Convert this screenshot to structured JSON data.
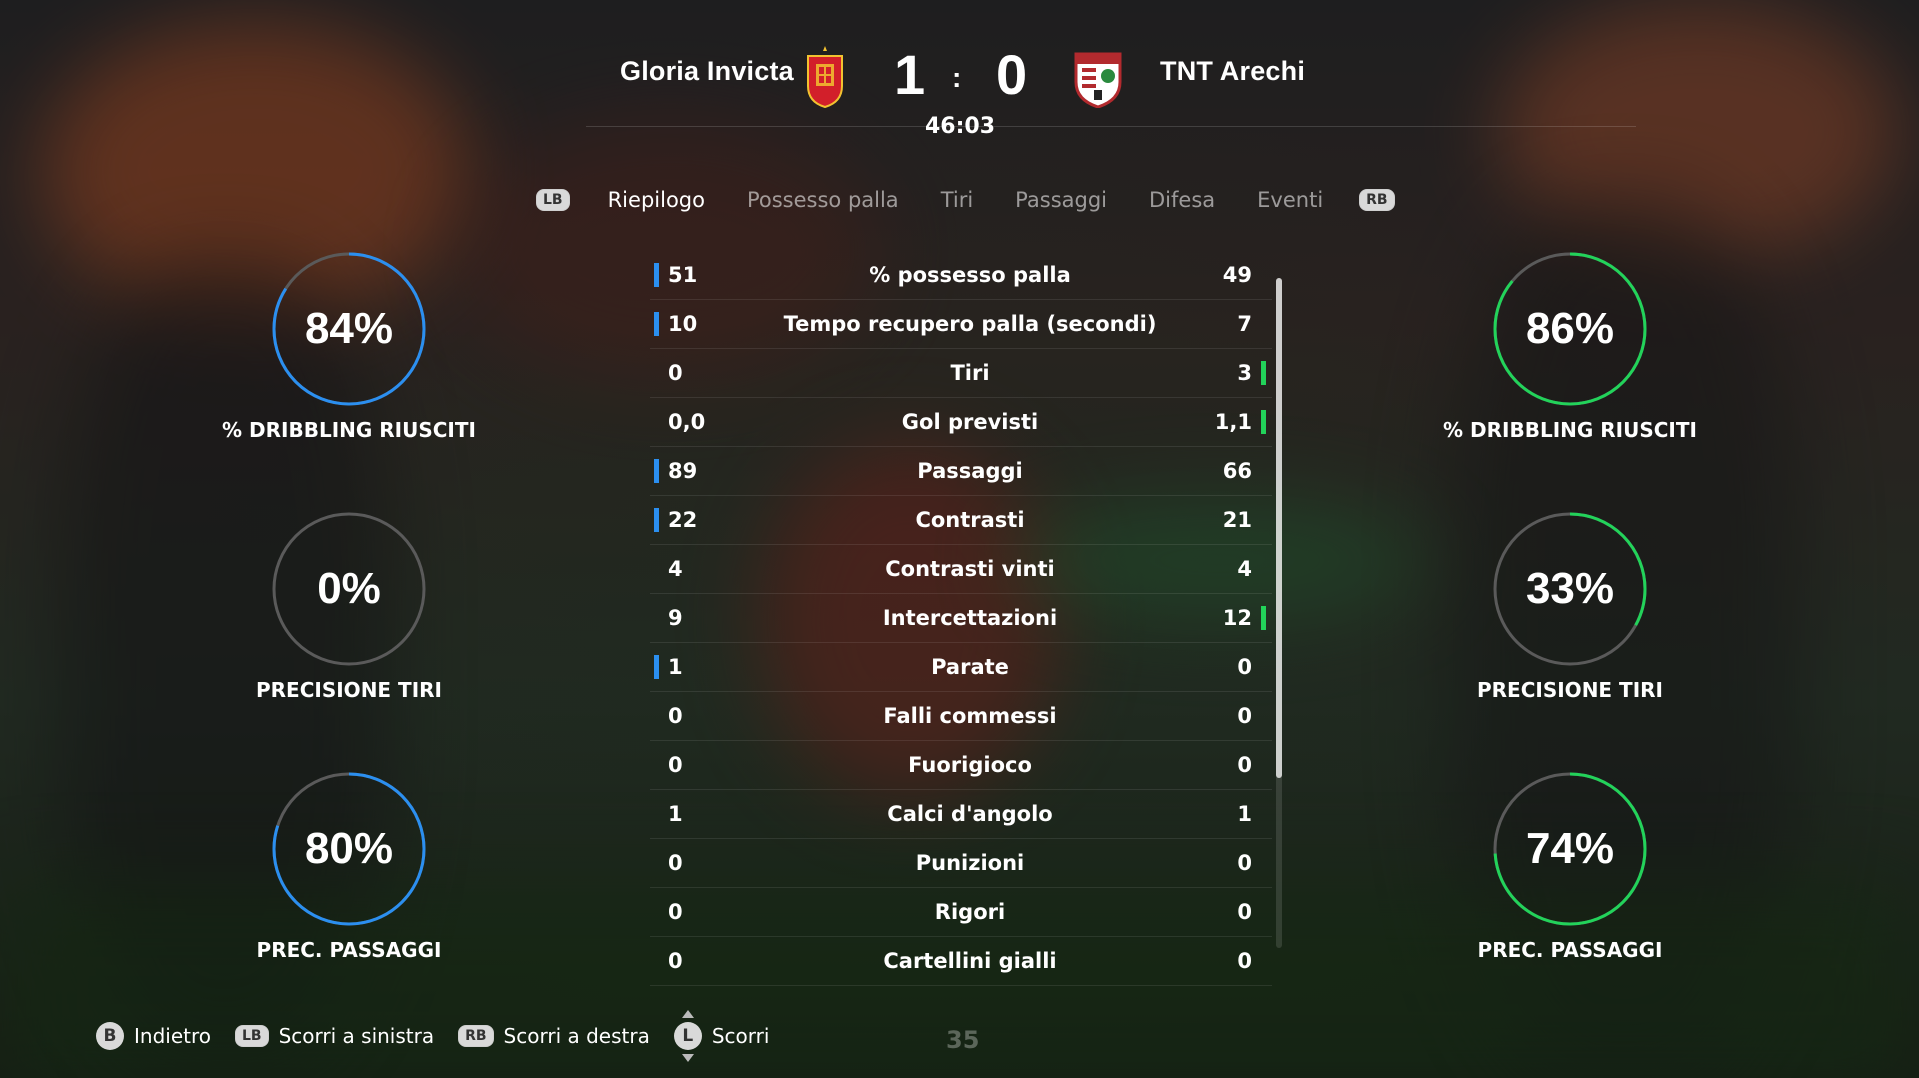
{
  "match": {
    "home_team": "Gloria Invicta",
    "away_team": "TNT Arechi",
    "home_score": "1",
    "away_score": "0",
    "separator": ":",
    "clock": "46:03",
    "home_crest_icon": "spain-crest-icon",
    "away_crest_icon": "club-crest-icon"
  },
  "tabs": {
    "lb": "LB",
    "rb": "RB",
    "items": [
      "Riepilogo",
      "Possesso palla",
      "Tiri",
      "Passaggi",
      "Difesa",
      "Eventi"
    ],
    "active": "Riepilogo"
  },
  "colors": {
    "home": "#2b8ff0",
    "away": "#22d35a",
    "ring_track": "#5a5a5a"
  },
  "home_rings": [
    {
      "value": "84%",
      "percent": 84,
      "label": "% DRIBBLING RIUSCITI"
    },
    {
      "value": "0%",
      "percent": 0,
      "label": "PRECISIONE TIRI"
    },
    {
      "value": "80%",
      "percent": 80,
      "label": "PREC. PASSAGGI"
    }
  ],
  "away_rings": [
    {
      "value": "86%",
      "percent": 86,
      "label": "% DRIBBLING RIUSCITI"
    },
    {
      "value": "33%",
      "percent": 33,
      "label": "PRECISIONE TIRI"
    },
    {
      "value": "74%",
      "percent": 74,
      "label": "PREC. PASSAGGI"
    }
  ],
  "stats": [
    {
      "home": "51",
      "name": "% possesso palla",
      "away": "49",
      "leader": "home"
    },
    {
      "home": "10",
      "name": "Tempo recupero palla (secondi)",
      "away": "7",
      "leader": "home"
    },
    {
      "home": "0",
      "name": "Tiri",
      "away": "3",
      "leader": "away"
    },
    {
      "home": "0,0",
      "name": "Gol previsti",
      "away": "1,1",
      "leader": "away"
    },
    {
      "home": "89",
      "name": "Passaggi",
      "away": "66",
      "leader": "home"
    },
    {
      "home": "22",
      "name": "Contrasti",
      "away": "21",
      "leader": "home"
    },
    {
      "home": "4",
      "name": "Contrasti vinti",
      "away": "4",
      "leader": "none"
    },
    {
      "home": "9",
      "name": "Intercettazioni",
      "away": "12",
      "leader": "away"
    },
    {
      "home": "1",
      "name": "Parate",
      "away": "0",
      "leader": "home"
    },
    {
      "home": "0",
      "name": "Falli commessi",
      "away": "0",
      "leader": "none"
    },
    {
      "home": "0",
      "name": "Fuorigioco",
      "away": "0",
      "leader": "none"
    },
    {
      "home": "1",
      "name": "Calci d'angolo",
      "away": "1",
      "leader": "none"
    },
    {
      "home": "0",
      "name": "Punizioni",
      "away": "0",
      "leader": "none"
    },
    {
      "home": "0",
      "name": "Rigori",
      "away": "0",
      "leader": "none"
    },
    {
      "home": "0",
      "name": "Cartellini gialli",
      "away": "0",
      "leader": "none"
    }
  ],
  "footer": {
    "back_key": "B",
    "back_label": "Indietro",
    "lb_key": "LB",
    "lb_label": "Scorri a sinistra",
    "rb_key": "RB",
    "rb_label": "Scorri a destra",
    "stick_key": "L",
    "stick_label": "Scorri",
    "page_number": "35"
  }
}
